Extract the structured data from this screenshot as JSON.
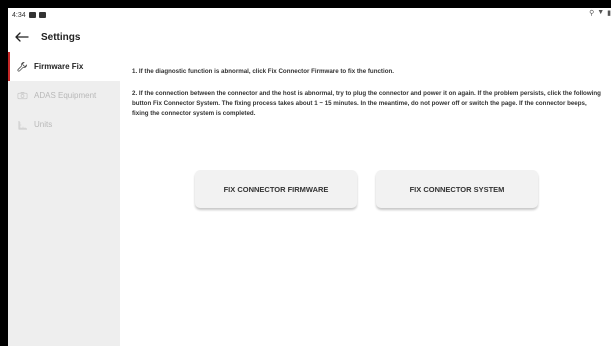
{
  "status_bar": {
    "time": "4:34"
  },
  "header": {
    "title": "Settings"
  },
  "sidebar": {
    "items": [
      {
        "label": "Firmware Fix",
        "icon": "wrench-icon",
        "active": true
      },
      {
        "label": "ADAS Equipment",
        "icon": "camera-icon",
        "active": false
      },
      {
        "label": "Units",
        "icon": "ruler-icon",
        "active": false
      }
    ]
  },
  "main": {
    "instruction_1": "1. If the diagnostic function is abnormal, click Fix Connector Firmware to fix the function.",
    "instruction_2": "2. If the connection between the connector and the host is abnormal, try to plug the connector and power it on again. If the problem persists, click the following button Fix Connector System. The fixing process takes about 1 ~ 15 minutes. In the meantime, do not power off or switch the page. If the connector beeps, fixing the connector system is completed.",
    "buttons": {
      "fix_firmware": "FIX CONNECTOR FIRMWARE",
      "fix_system": "FIX CONNECTOR SYSTEM"
    }
  },
  "colors": {
    "accent": "#c62828",
    "sidebar_bg": "#eeeeee"
  }
}
